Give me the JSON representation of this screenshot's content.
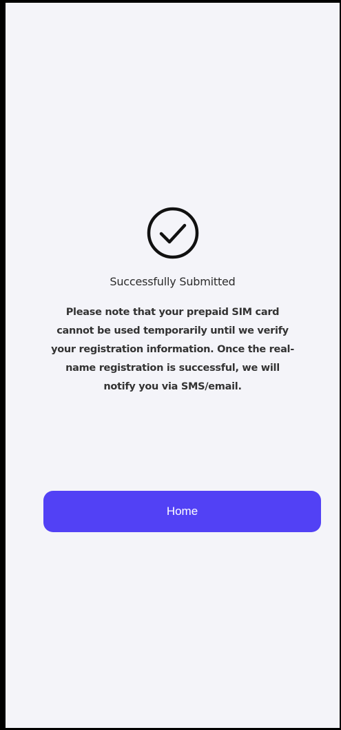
{
  "success": {
    "icon": "check-circle-icon",
    "title": "Successfully Submitted",
    "message": "Please note that your prepaid SIM card cannot be used temporarily until we verify your registration information. Once the real-name registration is successful, we will notify you via SMS/email."
  },
  "actions": {
    "home_label": "Home"
  },
  "colors": {
    "background": "#f4f4f9",
    "accent": "#5241f5",
    "text": "#333333"
  }
}
